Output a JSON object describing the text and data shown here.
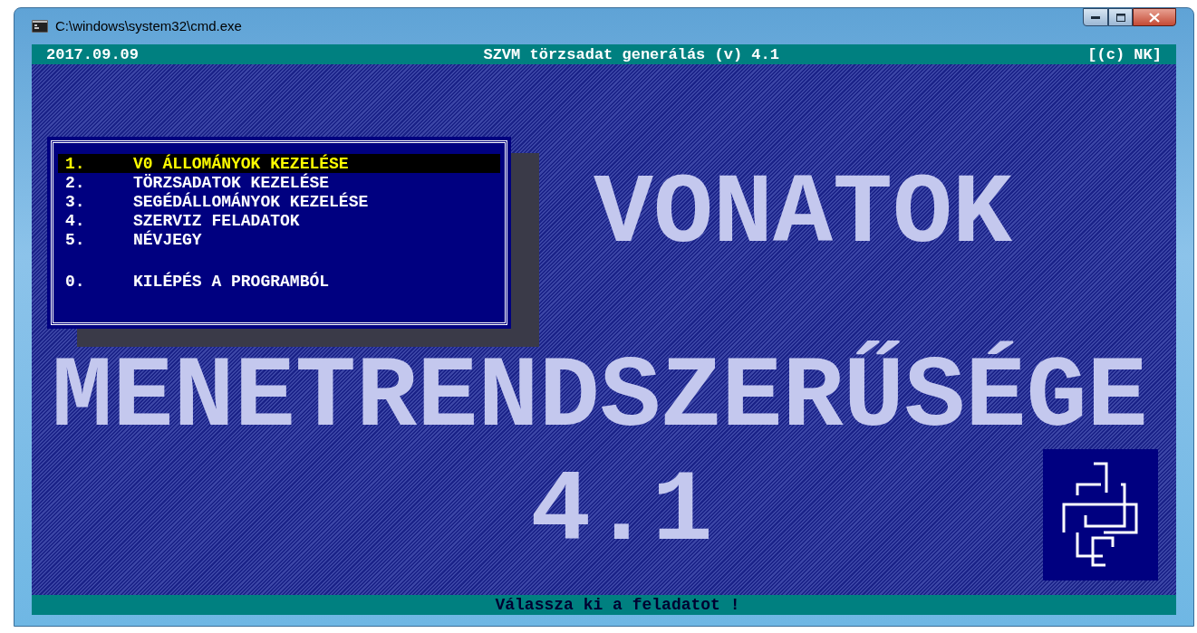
{
  "window": {
    "title": "C:\\windows\\system32\\cmd.exe"
  },
  "header": {
    "date": "2017.09.09",
    "title": "SZVM törzsadat generálás (v) 4.1",
    "copyright": "[(c) NK]"
  },
  "menu": {
    "items": [
      {
        "kind": "task",
        "number": "1.",
        "label": "V0 ÁLLOMÁNYOK KEZELÉSE",
        "selected": true
      },
      {
        "kind": "task",
        "number": "2.",
        "label": "TÖRZSADATOK KEZELÉSE",
        "selected": false
      },
      {
        "kind": "task",
        "number": "3.",
        "label": "SEGÉDÁLLOMÁNYOK KEZELÉSE",
        "selected": false
      },
      {
        "kind": "task",
        "number": "4.",
        "label": "SZERVIZ FELADATOK",
        "selected": false
      },
      {
        "kind": "task",
        "number": "5.",
        "label": "NÉVJEGY",
        "selected": false
      },
      {
        "kind": "exit",
        "number": "0.",
        "label": "KILÉPÉS A PROGRAMBÓL",
        "selected": false
      }
    ]
  },
  "banner": {
    "lines": [
      "VONATOK",
      "MENETRENDSZERŰSÉGE",
      "4.1"
    ]
  },
  "status_bar": {
    "text": "Válassza ki a feladatot !"
  }
}
